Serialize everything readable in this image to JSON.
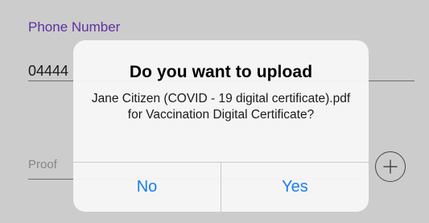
{
  "form": {
    "phone_label": "Phone Number",
    "phone_value": "04444",
    "proof_label": "Proof",
    "add_icon": "plus-circle-icon"
  },
  "alert": {
    "title": "Do you want to upload",
    "message": "Jane Citizen (COVID - 19 digital certificate).pdf for Vaccination Digital Certificate?",
    "no_label": "No",
    "yes_label": "Yes"
  },
  "colors": {
    "accent": "#1a7cf5",
    "label_purple": "#7a3fc8",
    "alert_background": "#f6f6f6"
  }
}
